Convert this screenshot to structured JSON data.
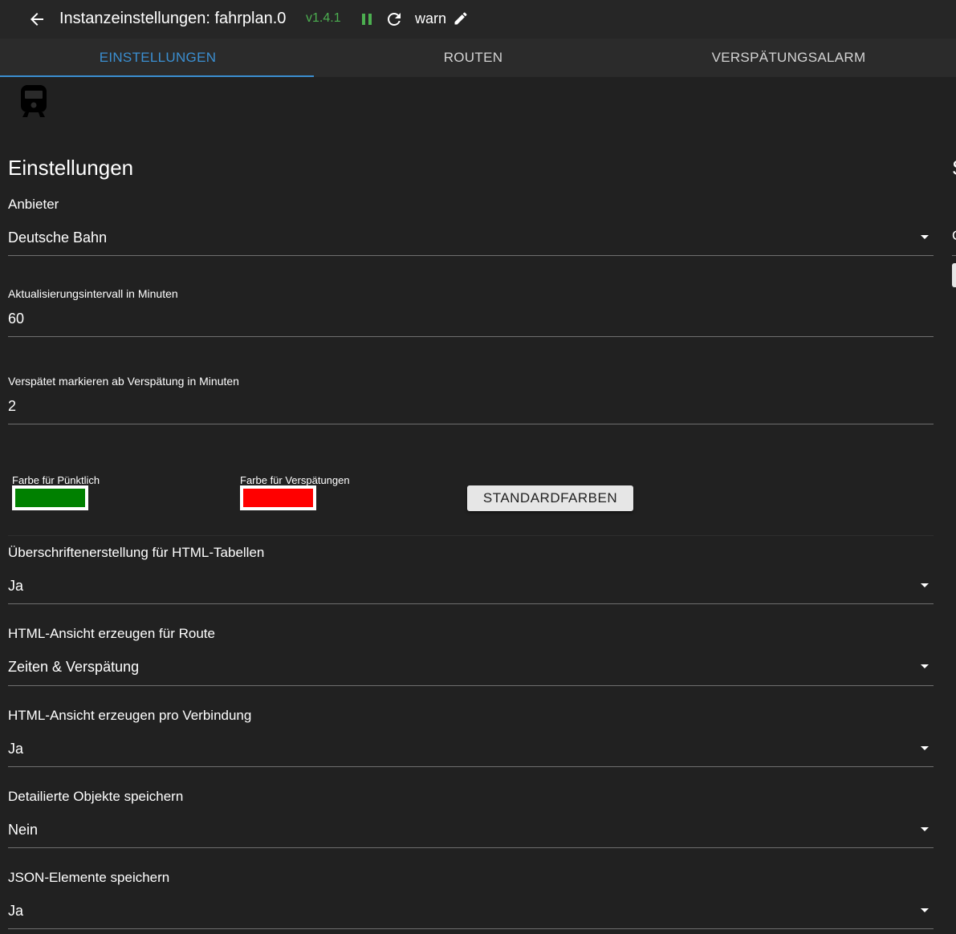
{
  "header": {
    "title": "Instanzeinstellungen: fahrplan.0",
    "version": "v1.4.1",
    "log_level": "warn"
  },
  "tabs": [
    {
      "label": "EINSTELLUNGEN",
      "active": true
    },
    {
      "label": "ROUTEN",
      "active": false
    },
    {
      "label": "VERSPÄTUNGSALARM",
      "active": false
    }
  ],
  "section": {
    "title": "Einstellungen"
  },
  "fields": {
    "provider": {
      "label": "Anbieter",
      "value": "Deutsche Bahn"
    },
    "update_interval": {
      "label": "Aktualisierungsintervall in Minuten",
      "value": "60"
    },
    "delay_threshold": {
      "label": "Verspätet markieren ab Verspätung in Minuten",
      "value": "2"
    },
    "table_headers": {
      "label": "Überschriftenerstellung für HTML-Tabellen",
      "value": "Ja"
    },
    "route_view": {
      "label": "HTML-Ansicht erzeugen für Route",
      "value": "Zeiten & Verspätung"
    },
    "connection_view": {
      "label": "HTML-Ansicht erzeugen pro Verbindung",
      "value": "Ja"
    },
    "detailed_objects": {
      "label": "Detailierte Objekte speichern",
      "value": "Nein"
    },
    "json_elements": {
      "label": "JSON-Elemente speichern",
      "value": "Ja"
    }
  },
  "colors": {
    "on_time": {
      "label": "Farbe für Pünktlich",
      "value": "#008000"
    },
    "delayed": {
      "label": "Farbe für Verspätungen",
      "value": "#ff0000"
    },
    "reset_button": "STANDARDFARBEN"
  },
  "right_panel": {
    "title_fragment": "S",
    "label_fragment": "C"
  },
  "theme": {
    "accent": "#3b8fd1",
    "version_color": "#4caf50",
    "background": "#212121"
  }
}
